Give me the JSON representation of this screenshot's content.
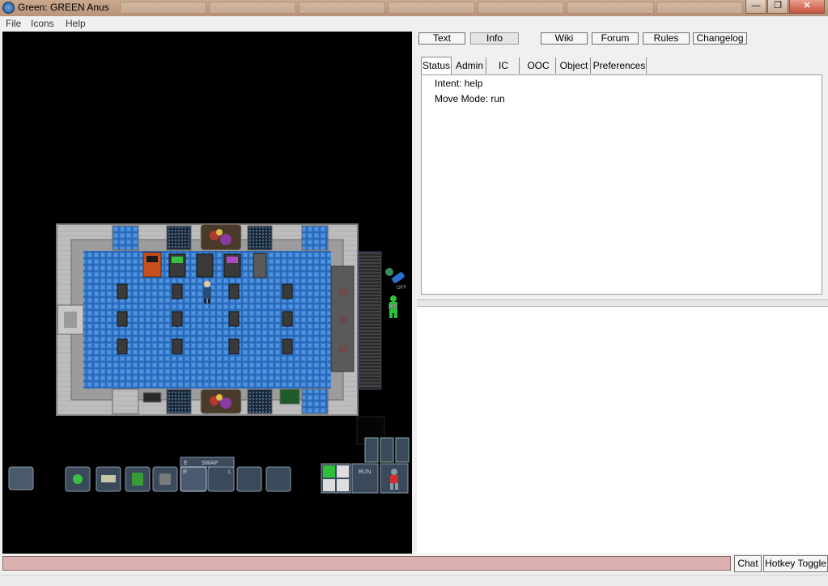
{
  "window": {
    "title": "Green: GREEN Anus"
  },
  "menu": {
    "file": "File",
    "icons": "Icons",
    "help": "Help"
  },
  "top_buttons": {
    "text": "Text",
    "info": "Info",
    "wiki": "Wiki",
    "forum": "Forum",
    "rules": "Rules",
    "changelog": "Changelog"
  },
  "tabs": {
    "status": "Status",
    "admin": "Admin",
    "ic": "IC",
    "ooc": "OOC",
    "object": "Object",
    "preferences": "Preferences"
  },
  "status": {
    "intent": "Intent: help",
    "move_mode": "Move Mode: run"
  },
  "hud": {
    "swap_label": "SWAP",
    "swap_key": "E",
    "hand_right": "R",
    "hand_left": "L",
    "internals": "OFF",
    "health": "100",
    "run_label": "RUN"
  },
  "bottom": {
    "chat": "Chat",
    "hotkey_toggle": "Hotkey Toggle"
  },
  "colors": {
    "titlebar": "#c0a088",
    "floor": "#3a7fd0",
    "input_bg": "#ddb0b0"
  }
}
